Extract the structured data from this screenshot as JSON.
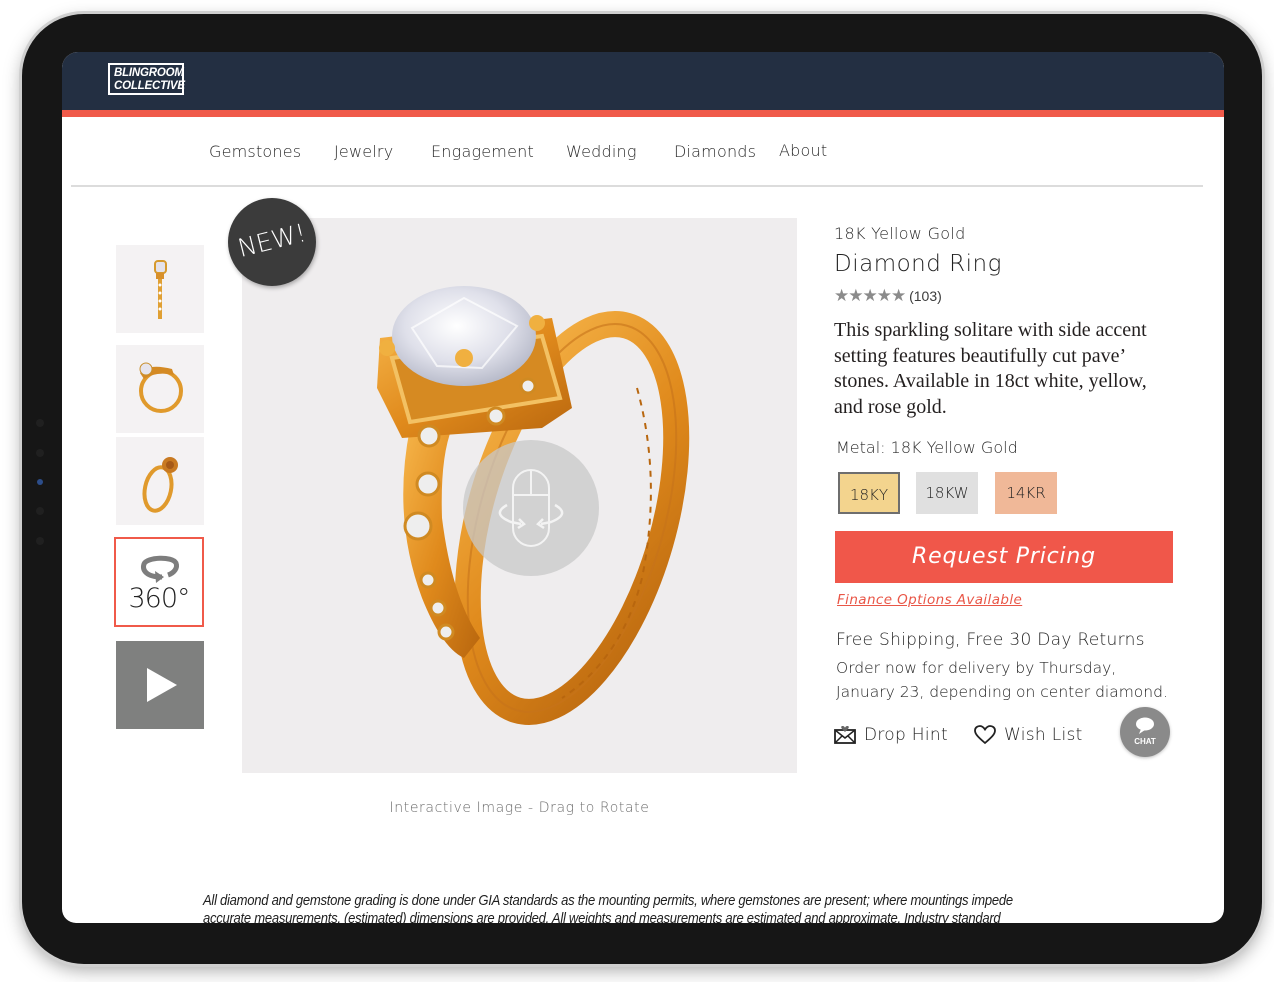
{
  "brand": {
    "logo_line1": "BLINGROOM",
    "logo_line2": "COLLECTIVE"
  },
  "colors": {
    "header_bg": "#232f42",
    "accent": "#f05a4a",
    "badge_bg": "#3b3b3b"
  },
  "nav": {
    "items": [
      {
        "label": "Gemstones"
      },
      {
        "label": "Jewelry"
      },
      {
        "label": "Engagement"
      },
      {
        "label": "Wedding"
      },
      {
        "label": "Diamonds"
      },
      {
        "label": "About"
      }
    ]
  },
  "gallery": {
    "thumbnails": [
      {
        "icon": "ring-side-view"
      },
      {
        "icon": "ring-profile-view"
      },
      {
        "icon": "ring-angled-view"
      }
    ],
    "view360_label": "360°",
    "video_icon": "play-icon",
    "badge": "NEW!",
    "rotate_icon": "mouse-rotate-icon",
    "caption": "Interactive Image - Drag to Rotate"
  },
  "product": {
    "subtitle": "18K Yellow Gold",
    "title": "Diamond Ring",
    "stars": "★★★★★",
    "rating": 5,
    "review_count": "(103)",
    "description": "This sparkling solitare with side accent setting features beautifully cut pave’ stones. Available in 18ct white, yellow, and rose gold.",
    "metal_label": "Metal: 18K Yellow Gold",
    "metal_options": [
      {
        "label": "18KY",
        "color": "#f3d48e",
        "selected": true
      },
      {
        "label": "18KW",
        "color": "#e0e0e0",
        "selected": false
      },
      {
        "label": "14KR",
        "color": "#f0b898",
        "selected": false
      }
    ],
    "request_button": "Request Pricing",
    "finance_link": "Finance Options Available",
    "shipping": "Free Shipping, Free 30 Day Returns",
    "delivery": "Order now for delivery by Thursday, January 23, depending on center diamond.",
    "drop_hint": "Drop Hint",
    "wish_list": "Wish List",
    "chat_label": "CHAT"
  },
  "footer": {
    "disclaimer": "All diamond and gemstone grading is done under GIA standards as the mounting permits, where gemstones are present; where mountings impede accurate measurements, (estimated) dimensions are provided. All weights and measurements are estimated and approximate. Industry standard and accepted treatments"
  }
}
